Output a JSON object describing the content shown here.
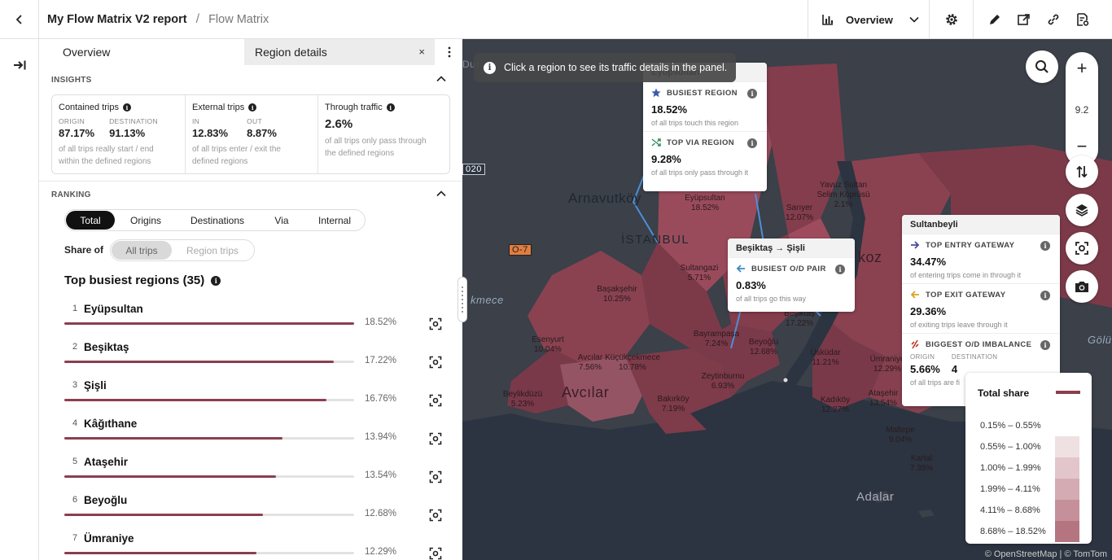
{
  "header": {
    "report_title": "My Flow Matrix V2 report",
    "separator": "/",
    "page_title": "Flow Matrix",
    "view_label": "Overview"
  },
  "icons": {
    "back": "chevron-left-icon",
    "view": "chart-icon",
    "view_dropdown": "chevron-down-icon",
    "settings": "gear-icon",
    "edit": "pencil-icon",
    "export": "export-icon",
    "link": "link-icon",
    "report": "report-settings-icon",
    "expand_panel": "arrow-right-to-bar-icon"
  },
  "panel": {
    "tabs": {
      "overview": "Overview",
      "region_details": "Region details",
      "close": "×"
    },
    "insights": {
      "header": "INSIGHTS",
      "contained": {
        "title": "Contained trips",
        "origin_key": "ORIGIN",
        "origin_val": "87.17%",
        "dest_key": "DESTINATION",
        "dest_val": "91.13%",
        "desc": "of all trips really start / end within the defined regions"
      },
      "external": {
        "title": "External trips",
        "in_key": "IN",
        "in_val": "12.83%",
        "out_key": "OUT",
        "out_val": "8.87%",
        "desc": "of all trips enter / exit the defined regions"
      },
      "through": {
        "title": "Through traffic",
        "value": "2.6%",
        "desc": "of all trips only pass through the defined regions"
      }
    },
    "ranking": {
      "header": "RANKING",
      "modes": [
        "Total",
        "Origins",
        "Destinations",
        "Via",
        "Internal"
      ],
      "active_mode": "Total",
      "share_of_label": "Share of",
      "share_options": [
        "All trips",
        "Region trips"
      ],
      "active_share": "All trips",
      "title": "Top busiest regions (35)",
      "rows": [
        {
          "rank": "1",
          "name": "Eyüpsultan",
          "pct": "18.52%",
          "share": 18.52
        },
        {
          "rank": "2",
          "name": "Beşiktaş",
          "pct": "17.22%",
          "share": 17.22
        },
        {
          "rank": "3",
          "name": "Şişli",
          "pct": "16.76%",
          "share": 16.76
        },
        {
          "rank": "4",
          "name": "Kâğıthane",
          "pct": "13.94%",
          "share": 13.94
        },
        {
          "rank": "5",
          "name": "Ataşehir",
          "pct": "13.54%",
          "share": 13.54
        },
        {
          "rank": "6",
          "name": "Beyoğlu",
          "pct": "12.68%",
          "share": 12.68
        },
        {
          "rank": "7",
          "name": "Ümraniye",
          "pct": "12.29%",
          "share": 12.29
        }
      ]
    }
  },
  "map": {
    "hint": "Click a region to see its traffic details in the panel.",
    "zoom_level": "9.2",
    "zoom_in": "+",
    "zoom_out": "−",
    "places": {
      "arnavutkoy": "Arnavutköy",
      "istanbul": "İSTANBUL",
      "avcilar": "Avcılar",
      "adalar": "Adalar",
      "koz": "koz",
      "mece": "kmece",
      "golu": "Gölü",
      "road1": "020",
      "road2": "O-7",
      "dur": "Dur"
    },
    "regions": [
      {
        "name": "Eyüpsultan",
        "pct": "18.52%"
      },
      {
        "name": "Sarıyer",
        "pct": "12.07%"
      },
      {
        "name": "Yavuz Sultan Selim Köprüsü",
        "pct": "2.1%"
      },
      {
        "name": "Sultangazi",
        "pct": "5.71%"
      },
      {
        "name": "Başakşehir",
        "pct": "10.25%"
      },
      {
        "name": "Esenyurt",
        "pct": "10.04%"
      },
      {
        "name": "Avcılar",
        "pct": "7.56%"
      },
      {
        "name": "Küçükçekmece",
        "pct": "10.78%"
      },
      {
        "name": "Bayrampaşa",
        "pct": "7.24%"
      },
      {
        "name": "Beyoğlu",
        "pct": "12.68%"
      },
      {
        "name": "Beşiktaş",
        "pct": "17.22%"
      },
      {
        "name": "Üsküdar",
        "pct": "11.21%"
      },
      {
        "name": "Ümraniye",
        "pct": "12.29%"
      },
      {
        "name": "Zeytinburnu",
        "pct": "6.93%"
      },
      {
        "name": "Beylikdüzü",
        "pct": "5.23%"
      },
      {
        "name": "Bakırköy",
        "pct": "7.19%"
      },
      {
        "name": "Kadıköy",
        "pct": "12.27%"
      },
      {
        "name": "Ataşehir",
        "pct": "13.54%"
      },
      {
        "name": "Maltepe",
        "pct": "9.04%"
      },
      {
        "name": "Kartal",
        "pct": "7.35%"
      }
    ],
    "popup_eyup": {
      "title": "Eyüpsultan",
      "busiest_cap": "BUSIEST REGION",
      "busiest_val": "18.52%",
      "busiest_desc": "of all trips touch this region",
      "via_cap": "TOP VIA REGION",
      "via_val": "9.28%",
      "via_desc": "of all trips only pass through it"
    },
    "popup_besiktas": {
      "title": "Beşiktaş → Şişli",
      "cap": "BUSIEST O/D PAIR",
      "val": "0.83%",
      "desc": "of all trips go this way"
    },
    "popup_sultan": {
      "title": "Sultanbeyli",
      "entry_cap": "TOP ENTRY GATEWAY",
      "entry_val": "34.47%",
      "entry_desc": "of entering trips come in through it",
      "exit_cap": "TOP EXIT GATEWAY",
      "exit_val": "29.36%",
      "exit_desc": "of exiting trips leave through it",
      "imb_cap": "BIGGEST O/D IMBALANCE",
      "imb_origin_key": "ORIGIN",
      "imb_origin_val": "5.66%",
      "imb_dest_key": "DESTINATION",
      "imb_dest_val": "4",
      "imb_desc": "of all trips are fi"
    },
    "legend": {
      "title": "Total share",
      "ranges": [
        {
          "label": "0.15% – 0.55%",
          "color": "#ffffff"
        },
        {
          "label": "0.55% – 1.00%",
          "color": "#efe0e2"
        },
        {
          "label": "1.00% – 1.99%",
          "color": "#e2c6cb"
        },
        {
          "label": "1.99% – 4.11%",
          "color": "#d4abb3"
        },
        {
          "label": "4.11% – 8.68%",
          "color": "#c5909a"
        },
        {
          "label": "8.68% – 18.52%",
          "color": "#b47580"
        }
      ]
    },
    "attribution": "© OpenStreetMap | © TomTom",
    "colors": {
      "accent": "#8c3e4f",
      "water": "#2b3440",
      "land": "#3b4049"
    }
  }
}
